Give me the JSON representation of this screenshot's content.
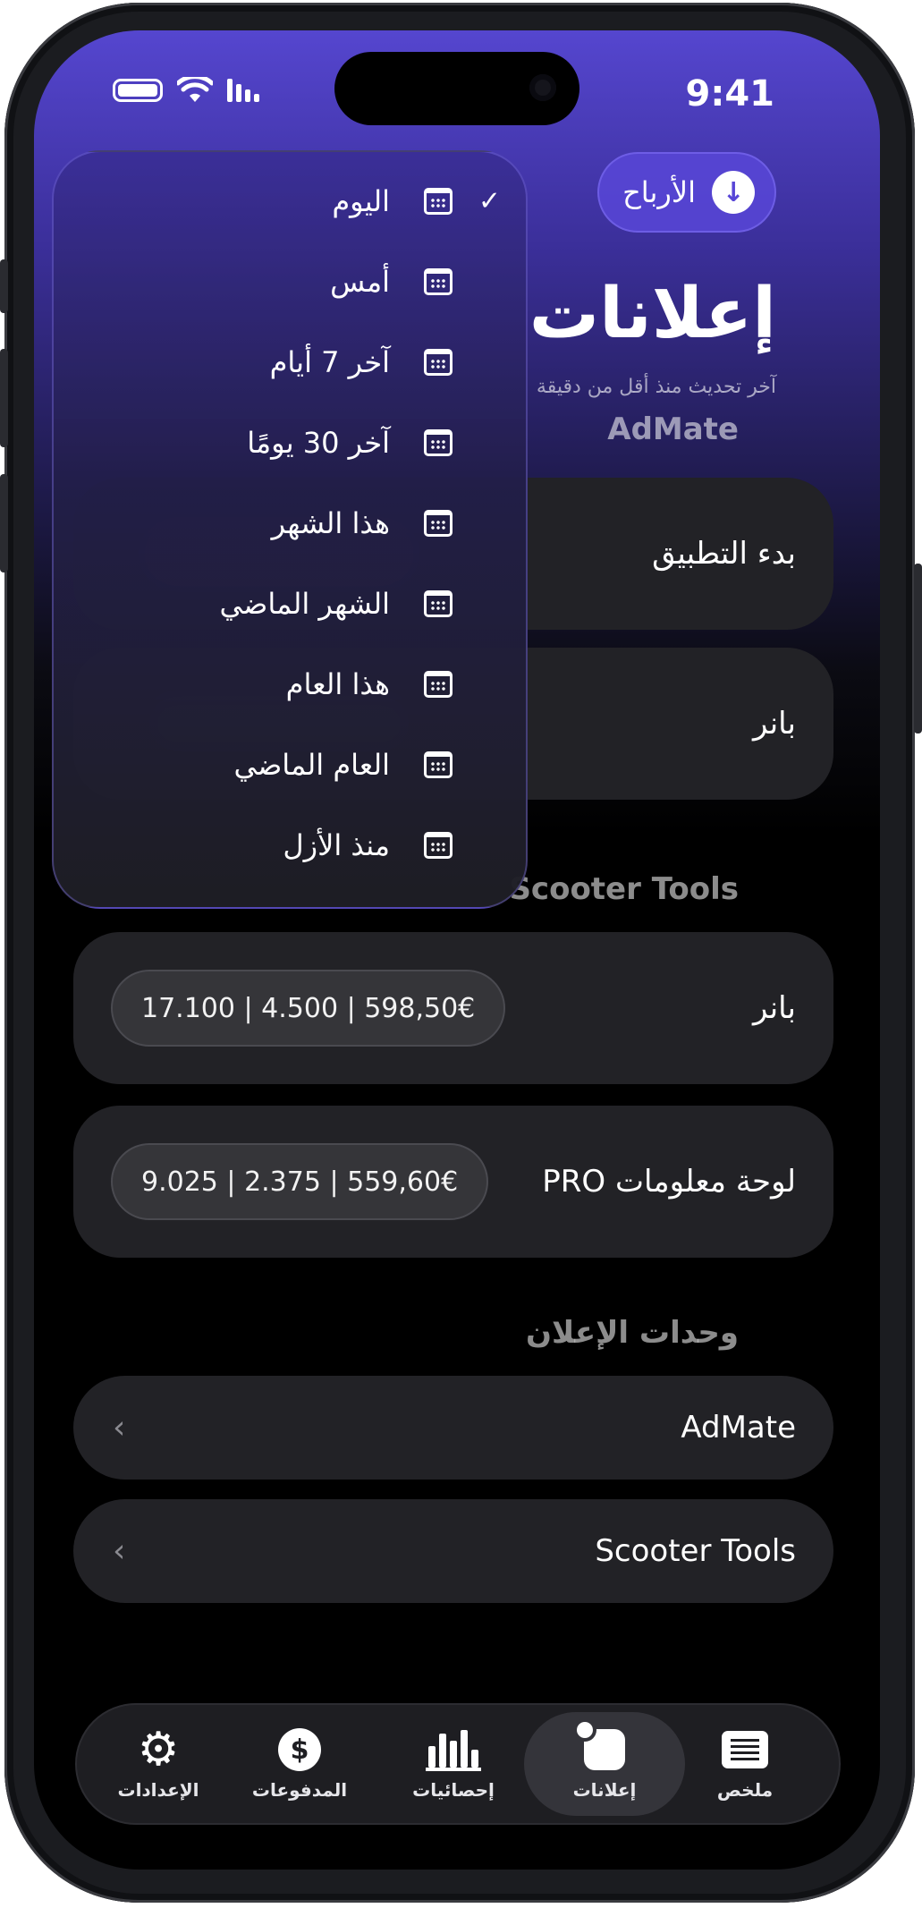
{
  "status_bar": {
    "time": "9:41"
  },
  "header": {
    "earnings_label": "الأرباح",
    "title": "إعلانات",
    "subtitle": "آخر تحديث منذ أقل من دقيقة"
  },
  "sections": [
    {
      "label": "AdMate",
      "cards": [
        {
          "label": "بدء التطبيق"
        },
        {
          "label": "بانر"
        }
      ]
    },
    {
      "label": "Scooter Tools",
      "cards": [
        {
          "label": "بانر",
          "stats": "17.100 | 4.500 | 598,50€"
        },
        {
          "label": "لوحة معلومات PRO",
          "stats": "9.025 | 2.375 | 559,60€"
        }
      ]
    }
  ],
  "ad_units": {
    "label": "وحدات الإعلان",
    "items": [
      {
        "label": "AdMate"
      },
      {
        "label": "Scooter Tools"
      }
    ]
  },
  "date_menu": {
    "selected_index": 0,
    "check_glyph": "✓",
    "items": [
      {
        "label": "اليوم"
      },
      {
        "label": "أمس"
      },
      {
        "label": "آخر 7 أيام"
      },
      {
        "label": "آخر 30 يومًا"
      },
      {
        "label": "هذا الشهر"
      },
      {
        "label": "الشهر الماضي"
      },
      {
        "label": "هذا العام"
      },
      {
        "label": "العام الماضي"
      },
      {
        "label": "منذ الأزل"
      }
    ]
  },
  "tab_bar": {
    "active_index": 1,
    "tabs": [
      {
        "label": "ملخص",
        "icon": "summary-icon"
      },
      {
        "label": "إعلانات",
        "icon": "ads-icon"
      },
      {
        "label": "إحصائيات",
        "icon": "stats-icon"
      },
      {
        "label": "المدفوعات",
        "icon": "payments-icon"
      },
      {
        "label": "الإعدادات",
        "icon": "settings-icon"
      }
    ]
  },
  "colors": {
    "accent": "#5846d7",
    "card": "#222226",
    "background": "#000000"
  }
}
